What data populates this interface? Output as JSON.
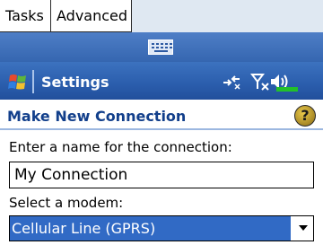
{
  "tabs": [
    {
      "label": "Tasks"
    },
    {
      "label": "Advanced"
    }
  ],
  "input_panel": {
    "icon": "keyboard-icon"
  },
  "titlebar": {
    "title": "Settings",
    "start_icon": "windows-flag-icon",
    "status_icons": [
      "connectivity-icon",
      "no-signal-icon",
      "volume-icon"
    ]
  },
  "header": {
    "title": "Make New Connection",
    "help_icon": "help-icon",
    "help_glyph": "?"
  },
  "form": {
    "name_label": "Enter a name for the connection:",
    "name_value": "My Connection",
    "modem_label": "Select a modem:",
    "modem_value": "Cellular Line (GPRS)"
  },
  "colors": {
    "titlebar": "#2c5fae",
    "header_title": "#123f8b",
    "selection": "#316ac5"
  }
}
